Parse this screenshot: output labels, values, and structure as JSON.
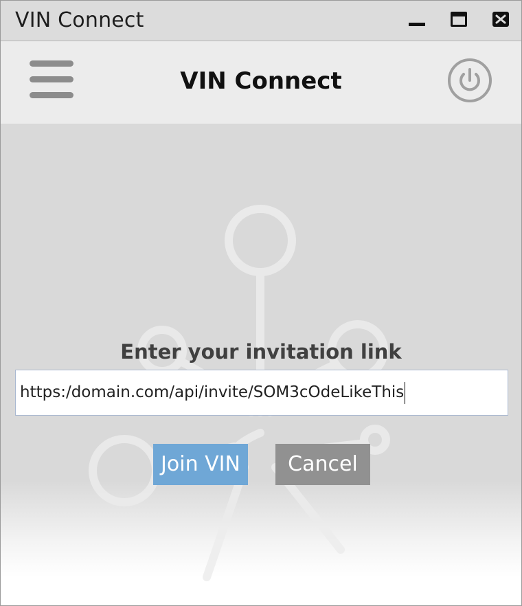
{
  "window": {
    "title": "VIN Connect",
    "controls": [
      "minimize-icon",
      "maximize-icon",
      "close-icon"
    ]
  },
  "header": {
    "title": "VIN Connect",
    "menu_icon": "hamburger-menu-icon",
    "power_icon": "power-icon"
  },
  "main": {
    "prompt": "Enter your invitation link",
    "link_value": "https:/domain.com/api/invite/SOM3cOdeLikeThis",
    "join_label": "Join VIN",
    "cancel_label": "Cancel",
    "background_icon": "network-nodes-icon"
  },
  "colors": {
    "join_button": "#6fa7d6",
    "cancel_button": "#919191",
    "header_bg": "#ececec",
    "main_bg": "#d9d9d9"
  }
}
